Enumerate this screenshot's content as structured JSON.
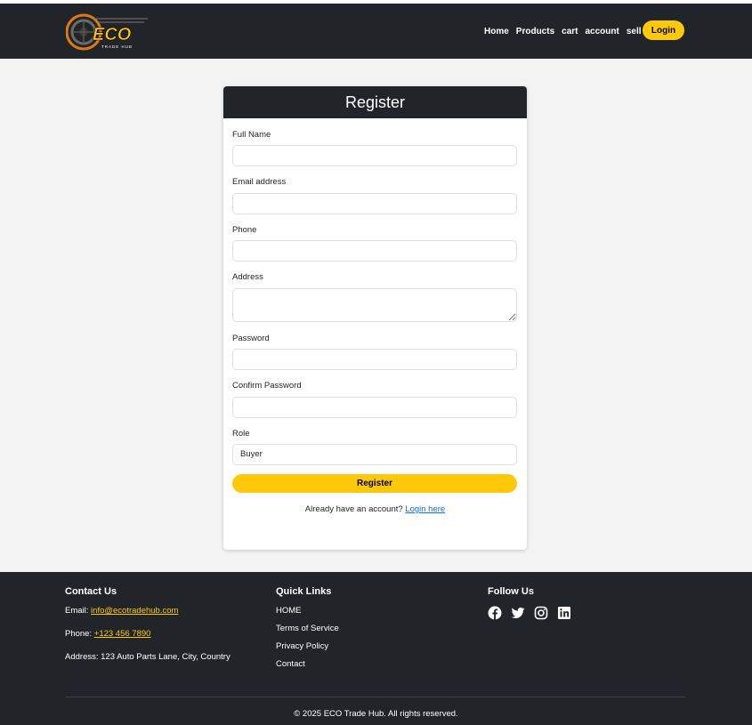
{
  "brand": {
    "logo_text": "ECO",
    "logo_subtext": "TRADE HUB",
    "accent_color": "#ffc90a",
    "dark_color": "#212529"
  },
  "nav": {
    "items": [
      "Home",
      "Products",
      "cart",
      "account",
      "sell"
    ],
    "login_label": "Login"
  },
  "form": {
    "title": "Register",
    "fields": {
      "full_name": {
        "label": "Full Name",
        "value": ""
      },
      "email": {
        "label": "Email address",
        "value": ""
      },
      "phone": {
        "label": "Phone",
        "value": ""
      },
      "address": {
        "label": "Address",
        "value": ""
      },
      "password": {
        "label": "Password",
        "value": ""
      },
      "confirm_password": {
        "label": "Confirm Password",
        "value": ""
      },
      "role": {
        "label": "Role",
        "value": "Buyer"
      }
    },
    "submit_label": "Register",
    "signin_prompt": "Already have an account?",
    "signin_link": "Login here"
  },
  "footer": {
    "contact": {
      "title": "Contact Us",
      "email_label": "Email:",
      "email": "info@ecotradehub.com",
      "phone_label": "Phone:",
      "phone": "+123 456 7890",
      "address": "Address: 123 Auto Parts Lane, City, Country"
    },
    "quick_links": {
      "title": "Quick Links",
      "items": [
        "HOME",
        "Terms of Service",
        "Privacy Policy",
        "Contact"
      ]
    },
    "follow": {
      "title": "Follow Us",
      "icons": [
        "facebook-icon",
        "twitter-icon",
        "instagram-icon",
        "linkedin-icon"
      ]
    },
    "copyright": "© 2025 ECO Trade Hub. All rights reserved."
  }
}
